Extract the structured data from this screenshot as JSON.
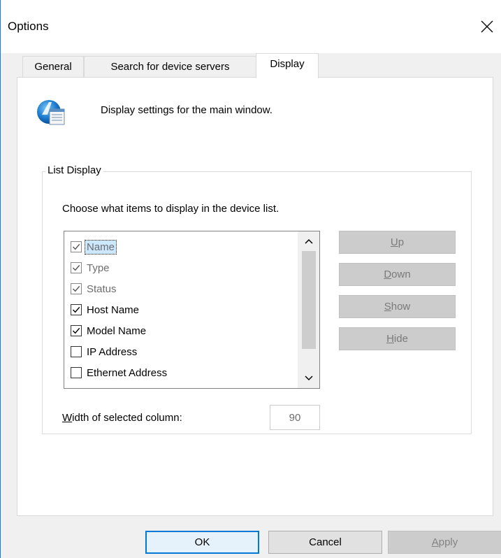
{
  "window": {
    "title": "Options"
  },
  "tabs": [
    {
      "label": "General"
    },
    {
      "label": "Search for device servers"
    },
    {
      "label": "Display"
    }
  ],
  "page": {
    "description": "Display settings for the main window.",
    "group_label": "List Display",
    "instruction": "Choose what items to display in the device list.",
    "list_items": [
      {
        "label": "Name",
        "checked": true,
        "enabled": false,
        "selected": true
      },
      {
        "label": "Type",
        "checked": true,
        "enabled": false,
        "selected": false
      },
      {
        "label": "Status",
        "checked": true,
        "enabled": false,
        "selected": false
      },
      {
        "label": "Host Name",
        "checked": true,
        "enabled": true,
        "selected": false
      },
      {
        "label": "Model Name",
        "checked": true,
        "enabled": true,
        "selected": false
      },
      {
        "label": "IP Address",
        "checked": false,
        "enabled": true,
        "selected": false
      },
      {
        "label": "Ethernet Address",
        "checked": false,
        "enabled": true,
        "selected": false
      }
    ],
    "side_buttons": {
      "up": {
        "mn": "U",
        "rest": "p"
      },
      "down": {
        "mn": "D",
        "rest": "own"
      },
      "show": {
        "mn": "S",
        "rest": "how"
      },
      "hide": {
        "mn": "H",
        "rest": "ide"
      }
    },
    "width_label": {
      "mn": "W",
      "rest": "idth of selected column:"
    },
    "width_value": "90"
  },
  "buttons": {
    "ok": "OK",
    "cancel": "Cancel",
    "apply": {
      "mn": "A",
      "rest": "pply"
    }
  },
  "colors": {
    "accent": "#0078d7",
    "selection": "#cce8ff",
    "disabled_button": "#cccccc"
  }
}
